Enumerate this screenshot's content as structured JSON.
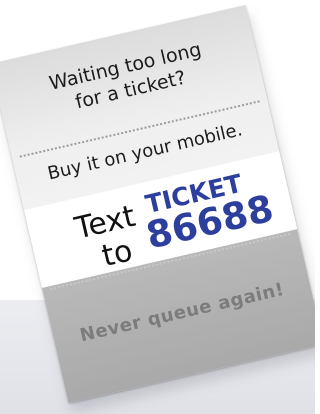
{
  "poster": {
    "line_waiting": "Waiting too long",
    "line_for_ticket": "for a ticket?",
    "line_buy": "Buy it on your mobile.",
    "word_text": "Text",
    "word_keyword": "TICKET",
    "word_to": "to",
    "shortcode": "86688",
    "line_never": "Never queue again!"
  },
  "colors": {
    "accent_blue": "#2d3f9c",
    "body_text": "#1c1c1c",
    "footer_text": "#7c7c7c",
    "footer_band": "#b0b0b0",
    "middle_band": "#ffffff",
    "top_band": "#e8e8e8"
  }
}
